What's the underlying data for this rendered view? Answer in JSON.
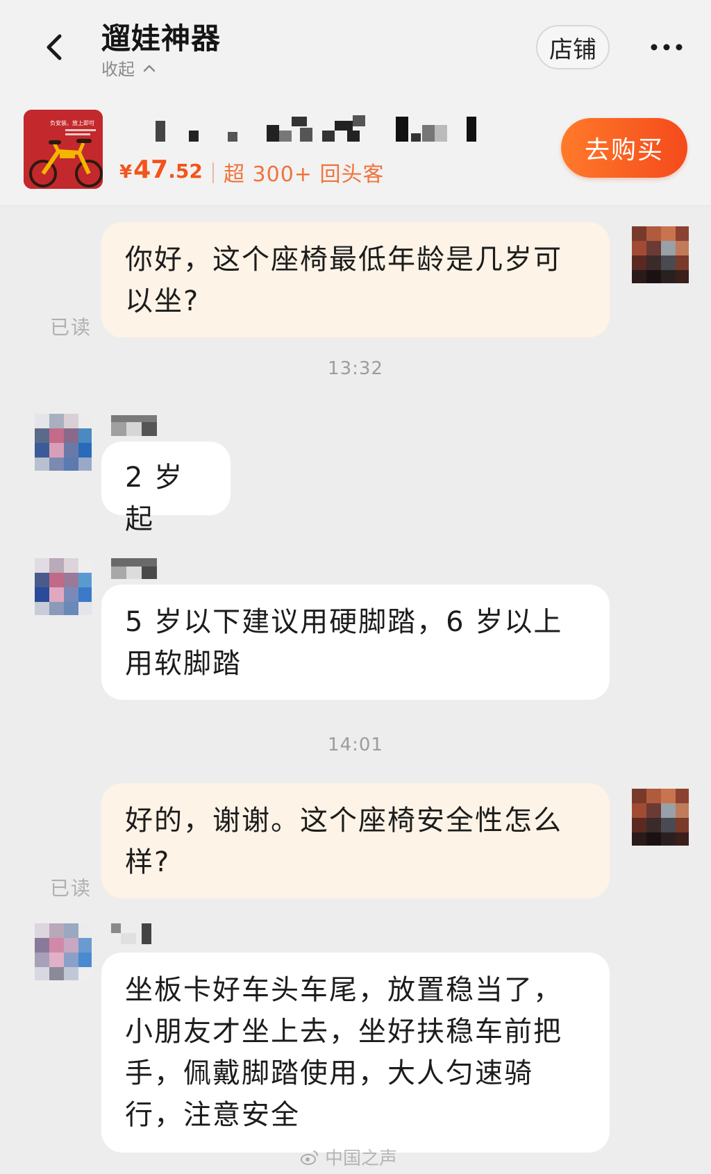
{
  "header": {
    "title": "遛娃神器",
    "collapse_label": "收起",
    "shop_label": "店铺"
  },
  "product": {
    "currency": "¥",
    "price_int": "47",
    "price_dec": ".52",
    "repeat_customers": "超 300+ 回头客",
    "buy_label": "去购买",
    "thumb_text_line1": "负安装、放上即可"
  },
  "chat": {
    "messages": [
      {
        "from": "me",
        "text_line1": "你好，这个座椅最低年龄是几岁可",
        "text_line2": "以坐?",
        "status": "已读"
      },
      {
        "from": "other",
        "text_line1": "2 岁起"
      },
      {
        "from": "other",
        "text_line1": "5 岁以下建议用硬脚踏，6 岁以上",
        "text_line2": "用软脚踏"
      },
      {
        "from": "me",
        "text_line1": "好的，谢谢。这个座椅安全性怎么",
        "text_line2": "样?",
        "status": "已读"
      },
      {
        "from": "other",
        "text_line1": "坐板卡好车头车尾，放置稳当了，",
        "text_line2": "小朋友才坐上去，坐好扶稳车前把",
        "text_line3": "手，佩戴脚踏使用，大人匀速骑",
        "text_line4": "行，注意安全"
      }
    ],
    "timestamps": [
      "13:32",
      "14:01"
    ]
  },
  "watermark": "中国之声",
  "icons": [
    "back-icon",
    "chevron-up-icon",
    "more-icon",
    "weibo-icon"
  ],
  "colors": {
    "accent": "#f2541a",
    "buy_gradient_start": "#ff7a2a",
    "buy_gradient_end": "#f44a1b",
    "my_bubble": "#fdf3e6",
    "other_bubble": "#ffffff",
    "background": "#ededed"
  }
}
